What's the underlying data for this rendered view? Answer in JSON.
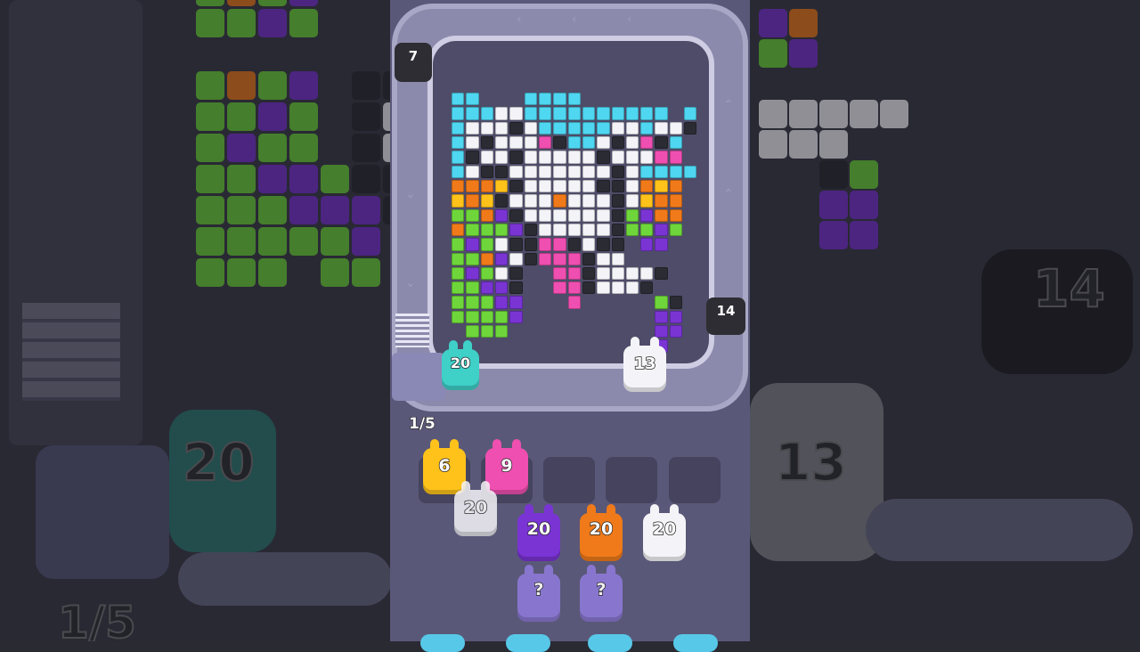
{
  "game": {
    "counter": "1/5",
    "pixel_art_subject": "bunny-with-flowers",
    "colors": {
      "cyan": "#4fd6f0",
      "white": "#f4f4f8",
      "black": "#2b2b33",
      "pink": "#ef4fb0",
      "orange": "#f07a1a",
      "yellow": "#ffc21a",
      "green": "#6ed63a",
      "purple": "#7a34d4",
      "teal": "#3fd0c8",
      "belt": "#8c8aac",
      "board": "#4e4c68"
    }
  },
  "belt_bunnies": [
    {
      "label": "7",
      "color": "black"
    },
    {
      "label": "14",
      "color": "black"
    },
    {
      "label": "20",
      "color": "teal"
    },
    {
      "label": "13",
      "color": "white"
    }
  ],
  "slots": [
    {
      "label": "6",
      "color": "yellow",
      "filled": true
    },
    {
      "label": "9",
      "color": "pink",
      "filled": true
    },
    {
      "label": "",
      "filled": false
    },
    {
      "label": "",
      "filled": false
    },
    {
      "label": "",
      "filled": false
    }
  ],
  "queue": [
    {
      "label": "20",
      "color": "white",
      "faded": true
    },
    {
      "label": "20",
      "color": "purple"
    },
    {
      "label": "20",
      "color": "orange"
    },
    {
      "label": "20",
      "color": "white"
    }
  ],
  "mystery": [
    {
      "label": "?",
      "color": "purple"
    },
    {
      "label": "?",
      "color": "purple"
    }
  ],
  "background": {
    "left_counter": "1/5",
    "left_bunny": "20",
    "right_bunny_top": "14",
    "right_bunny_bottom": "13"
  }
}
